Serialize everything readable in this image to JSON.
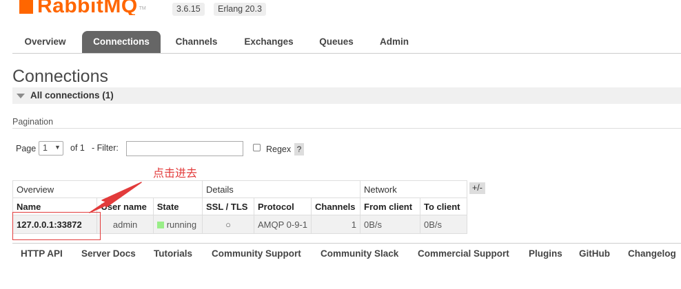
{
  "header": {
    "logo_text": "RabbitMQ",
    "logo_tm": "TM",
    "version": "3.6.15",
    "erlang": "Erlang 20.3",
    "brand_color": "#ff6600"
  },
  "tabs": [
    {
      "label": "Overview",
      "active": false
    },
    {
      "label": "Connections",
      "active": true
    },
    {
      "label": "Channels",
      "active": false
    },
    {
      "label": "Exchanges",
      "active": false
    },
    {
      "label": "Queues",
      "active": false
    },
    {
      "label": "Admin",
      "active": false
    }
  ],
  "page": {
    "title": "Connections",
    "section_title": "All connections (1)",
    "pagination_label": "Pagination"
  },
  "filter": {
    "page_label": "Page",
    "page_value": "1",
    "of_label": "of 1",
    "filter_label": "- Filter:",
    "filter_value": "",
    "regex_label": "Regex",
    "help_label": "?"
  },
  "annotation": {
    "text": "点击进去",
    "color": "#e23b3b"
  },
  "table": {
    "groups": [
      "Overview",
      "Details",
      "Network"
    ],
    "columns": [
      "Name",
      "User name",
      "State",
      "SSL / TLS",
      "Protocol",
      "Channels",
      "From client",
      "To client"
    ],
    "rows": [
      {
        "name": "127.0.0.1:33872",
        "user": "admin",
        "state": "running",
        "ssl": "○",
        "protocol": "AMQP 0-9-1",
        "channels": "1",
        "from_client": "0B/s",
        "to_client": "0B/s"
      }
    ],
    "columns_toggle": "+/-",
    "state_color": "#99ee88"
  },
  "footer": {
    "links": [
      "HTTP API",
      "Server Docs",
      "Tutorials",
      "Community Support",
      "Community Slack",
      "Commercial Support",
      "Plugins",
      "GitHub",
      "Changelog"
    ]
  }
}
